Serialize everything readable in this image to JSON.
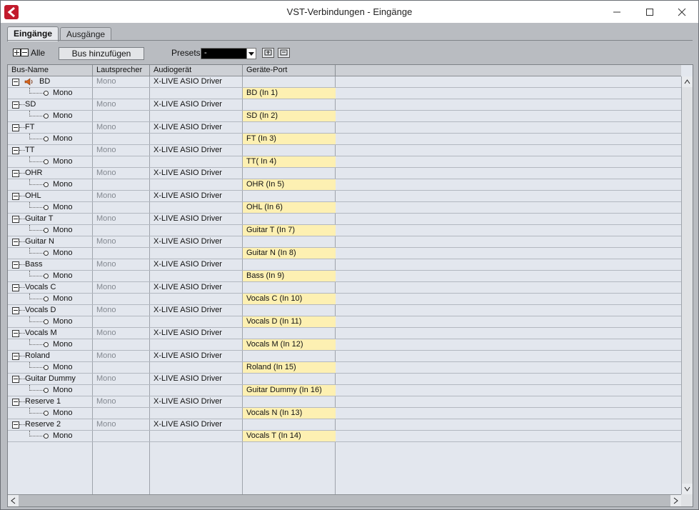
{
  "window": {
    "title": "VST-Verbindungen - Eingänge",
    "accent": "#c21a2c"
  },
  "tabs": [
    {
      "label": "Eingänge",
      "active": true
    },
    {
      "label": "Ausgänge",
      "active": false
    }
  ],
  "toolbar": {
    "all_label": "Alle",
    "add_bus_label": "Bus hinzufügen",
    "presets_label": "Presets",
    "presets_value": "-"
  },
  "table": {
    "columns": [
      "Bus-Name",
      "Lautsprecher",
      "Audiogerät",
      "Geräte-Port"
    ],
    "buses": [
      {
        "name": "BD",
        "speaker": "Mono",
        "device": "X-LIVE ASIO Driver",
        "channel": "Mono",
        "port": "BD (In 1)",
        "speaker_icon": true
      },
      {
        "name": "SD",
        "speaker": "Mono",
        "device": "X-LIVE ASIO Driver",
        "channel": "Mono",
        "port": "SD (In 2)"
      },
      {
        "name": "FT",
        "speaker": "Mono",
        "device": "X-LIVE ASIO Driver",
        "channel": "Mono",
        "port": "FT (In 3)"
      },
      {
        "name": "TT",
        "speaker": "Mono",
        "device": "X-LIVE ASIO Driver",
        "channel": "Mono",
        "port": "TT( In 4)"
      },
      {
        "name": "OHR",
        "speaker": "Mono",
        "device": "X-LIVE ASIO Driver",
        "channel": "Mono",
        "port": "OHR (In 5)"
      },
      {
        "name": "OHL",
        "speaker": "Mono",
        "device": "X-LIVE ASIO Driver",
        "channel": "Mono",
        "port": "OHL (In 6)"
      },
      {
        "name": "Guitar T",
        "speaker": "Mono",
        "device": "X-LIVE ASIO Driver",
        "channel": "Mono",
        "port": "Guitar T (In 7)"
      },
      {
        "name": "Guitar N",
        "speaker": "Mono",
        "device": "X-LIVE ASIO Driver",
        "channel": "Mono",
        "port": "Guitar N (In 8)"
      },
      {
        "name": "Bass",
        "speaker": "Mono",
        "device": "X-LIVE ASIO Driver",
        "channel": "Mono",
        "port": "Bass (In 9)"
      },
      {
        "name": "Vocals C",
        "speaker": "Mono",
        "device": "X-LIVE ASIO Driver",
        "channel": "Mono",
        "port": "Vocals C (In 10)"
      },
      {
        "name": "Vocals D",
        "speaker": "Mono",
        "device": "X-LIVE ASIO Driver",
        "channel": "Mono",
        "port": "Vocals D (In 11)"
      },
      {
        "name": "Vocals M",
        "speaker": "Mono",
        "device": "X-LIVE ASIO Driver",
        "channel": "Mono",
        "port": "Vocals M (In 12)"
      },
      {
        "name": "Roland",
        "speaker": "Mono",
        "device": "X-LIVE ASIO Driver",
        "channel": "Mono",
        "port": "Roland (In 15)"
      },
      {
        "name": "Guitar Dummy",
        "speaker": "Mono",
        "device": "X-LIVE ASIO Driver",
        "channel": "Mono",
        "port": "Guitar Dummy (In 16)"
      },
      {
        "name": "Reserve 1",
        "speaker": "Mono",
        "device": "X-LIVE ASIO Driver",
        "channel": "Mono",
        "port": "Vocals N (In 13)"
      },
      {
        "name": "Reserve 2",
        "speaker": "Mono",
        "device": "X-LIVE ASIO Driver",
        "channel": "Mono",
        "port": "Vocals T (In 14)"
      }
    ]
  }
}
